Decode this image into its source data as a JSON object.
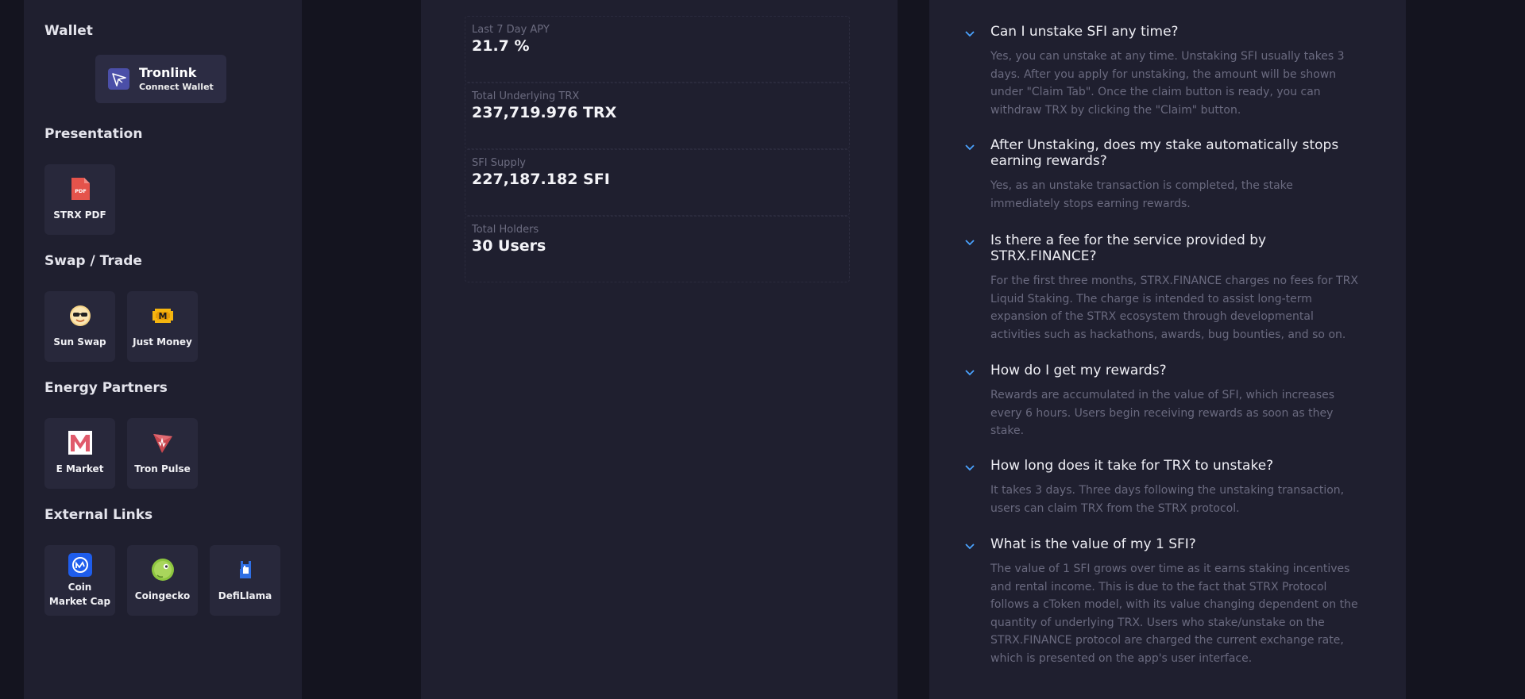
{
  "sidebar": {
    "wallet_title": "Wallet",
    "wallet": {
      "name": "Tronlink",
      "action": "Connect Wallet"
    },
    "presentation_title": "Presentation",
    "presentation": [
      {
        "label": "STRX PDF",
        "icon": "pdf-icon"
      }
    ],
    "swap_title": "Swap / Trade",
    "swap": [
      {
        "label": "Sun Swap",
        "icon": "sunswap-icon"
      },
      {
        "label": "Just Money",
        "icon": "justmoney-icon"
      }
    ],
    "energy_title": "Energy Partners",
    "energy": [
      {
        "label": "E Market",
        "icon": "emarket-icon"
      },
      {
        "label": "Tron Pulse",
        "icon": "tronpulse-icon"
      }
    ],
    "links_title": "External Links",
    "links": [
      {
        "label": "Coin Market Cap",
        "icon": "coinmarketcap-icon"
      },
      {
        "label": "Coingecko",
        "icon": "coingecko-icon"
      },
      {
        "label": "DefiLlama",
        "icon": "defillama-icon"
      }
    ]
  },
  "stats": [
    {
      "label": "Last 7 Day APY",
      "value": "21.7 %"
    },
    {
      "label": "Total Underlying TRX",
      "value": "237,719.976 TRX"
    },
    {
      "label": "SFI Supply",
      "value": "227,187.182 SFI"
    },
    {
      "label": "Total Holders",
      "value": "30 Users"
    }
  ],
  "faq": [
    {
      "q": "Can I unstake SFI any time?",
      "a": "Yes, you can unstake at any time. Unstaking SFI usually takes 3 days. After you apply for unstaking, the amount will be shown under \"Claim Tab\". Once the claim button is ready, you can withdraw TRX by clicking the \"Claim\" button."
    },
    {
      "q": "After Unstaking, does my stake automatically stops earning rewards?",
      "a": "Yes, as an unstake transaction is completed, the stake immediately stops earning rewards."
    },
    {
      "q": "Is there a fee for the service provided by STRX.FINANCE?",
      "a": "For the first three months, STRX.FINANCE charges no fees for TRX Liquid Staking. The charge is intended to assist long-term expansion of the STRX ecosystem through developmental activities such as hackathons, awards, bug bounties, and so on."
    },
    {
      "q": "How do I get my rewards?",
      "a": "Rewards are accumulated in the value of SFI, which increases every 6 hours. Users begin receiving rewards as soon as they stake."
    },
    {
      "q": "How long does it take for TRX to unstake?",
      "a": "It takes 3 days. Three days following the unstaking transaction, users can claim TRX from the STRX protocol."
    },
    {
      "q": "What is the value of my 1 SFI?",
      "a": "The value of 1 SFI grows over time as it earns staking incentives and rental income. This is due to the fact that STRX Protocol follows a cToken model, with its value changing dependent on the quantity of underlying TRX. Users who stake/unstake on the STRX.FINANCE protocol are charged the current exchange rate, which is presented on the app's user interface."
    }
  ],
  "colors": {
    "accent": "#4aa3ff",
    "panel": "#1f1f2f",
    "tile": "#28283b"
  }
}
